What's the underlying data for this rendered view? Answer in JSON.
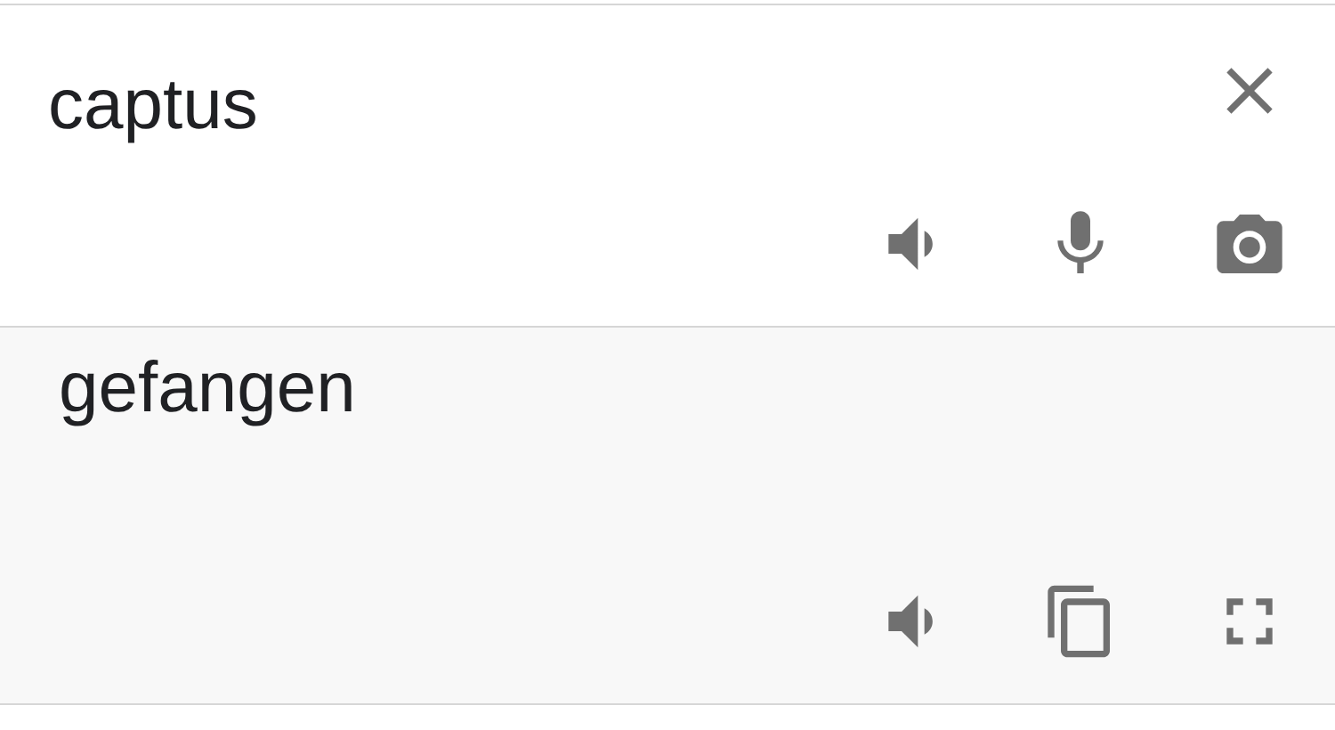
{
  "source": {
    "text": "captus"
  },
  "translation": {
    "text": "gefangen"
  }
}
